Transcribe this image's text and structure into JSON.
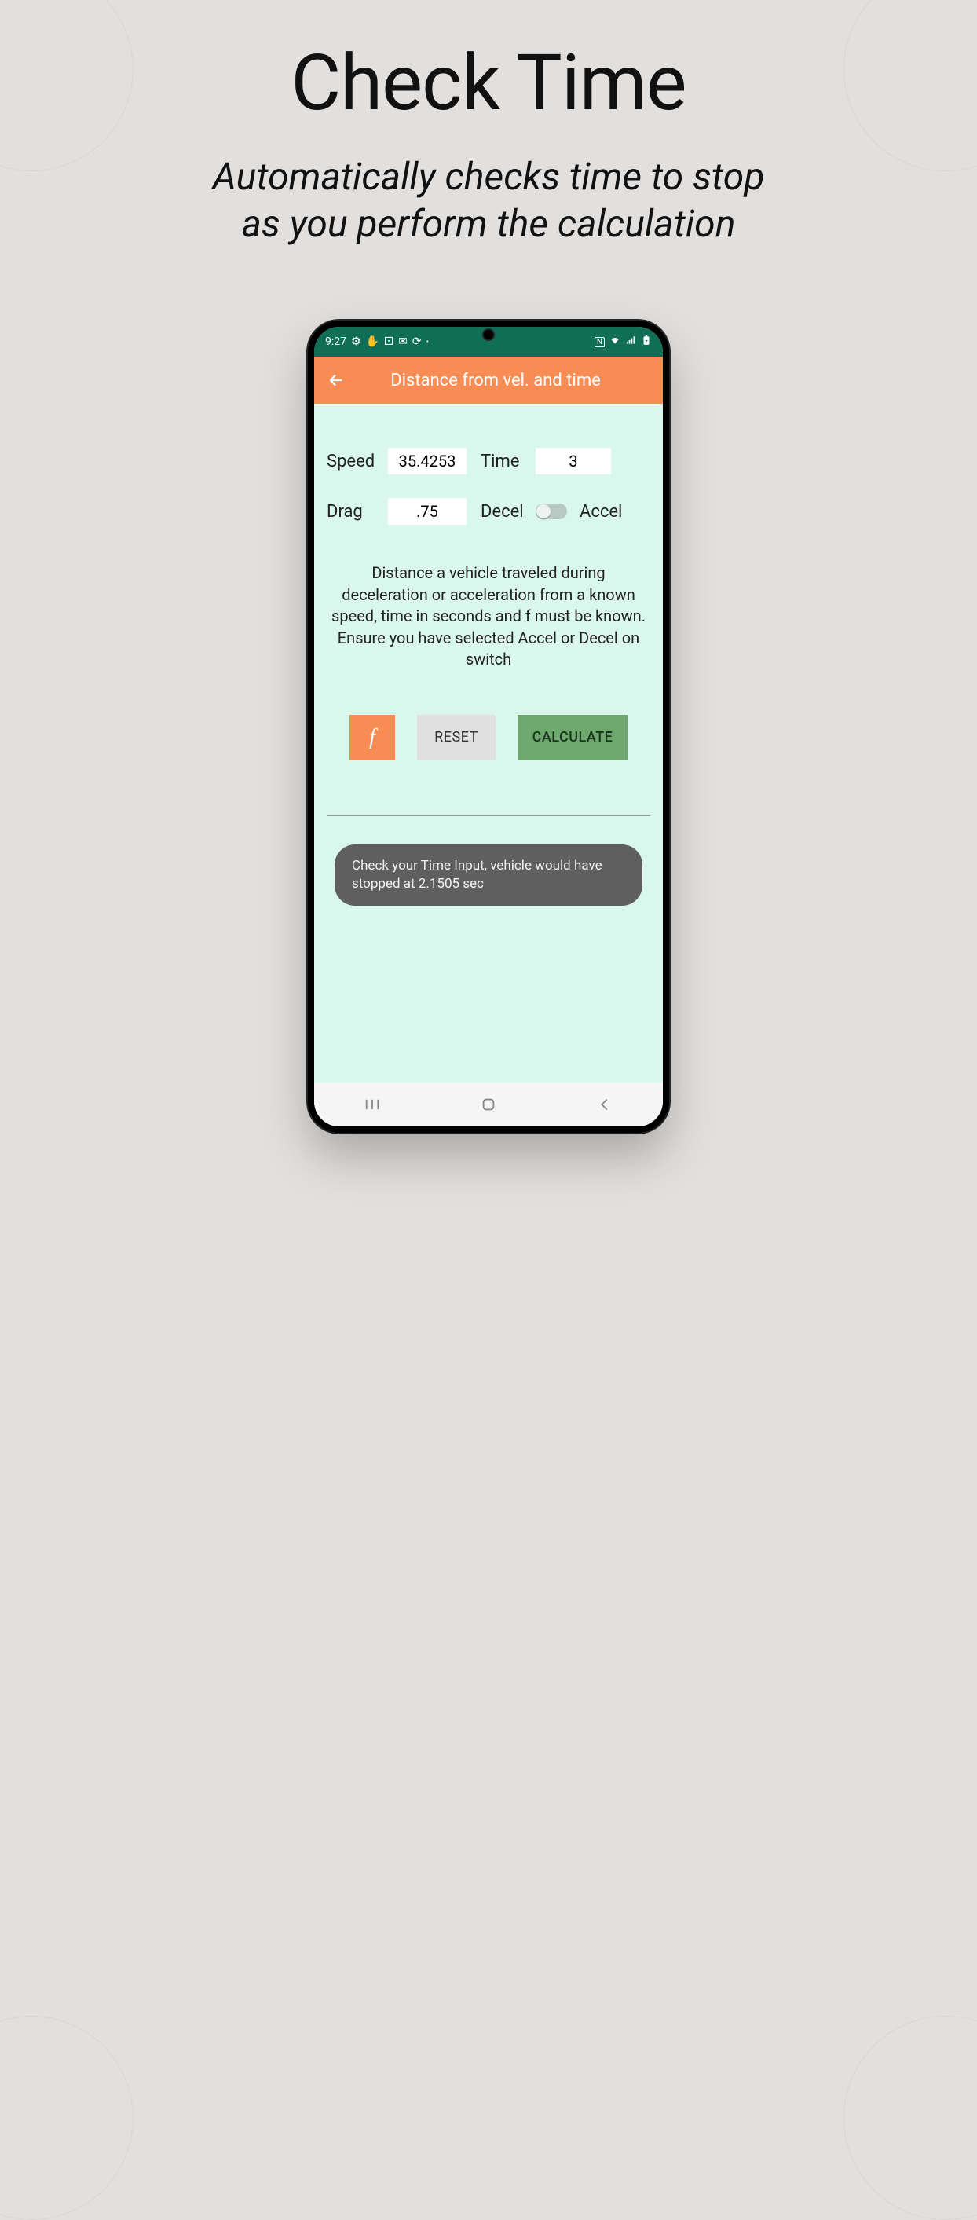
{
  "promo": {
    "title": "Check Time",
    "subtitle_l1": "Automatically checks time to stop",
    "subtitle_l2": "as you perform the calculation"
  },
  "status": {
    "time": "9:27",
    "nfc": "N"
  },
  "appbar": {
    "title": "Distance from vel. and time"
  },
  "fields": {
    "speed_label": "Speed",
    "speed_value": "35.4253",
    "time_label": "Time",
    "time_value": "3",
    "drag_label": "Drag",
    "drag_value": ".75",
    "decel_label": "Decel",
    "accel_label": "Accel"
  },
  "description": "Distance a vehicle traveled during deceleration or acceleration from a known speed, time in seconds and f must be known.  Ensure you have selected Accel or Decel on switch",
  "buttons": {
    "f": "f",
    "reset": "RESET",
    "calculate": "CALCULATE"
  },
  "toast": "Check your Time Input, vehicle would have stopped at 2.1505 sec"
}
